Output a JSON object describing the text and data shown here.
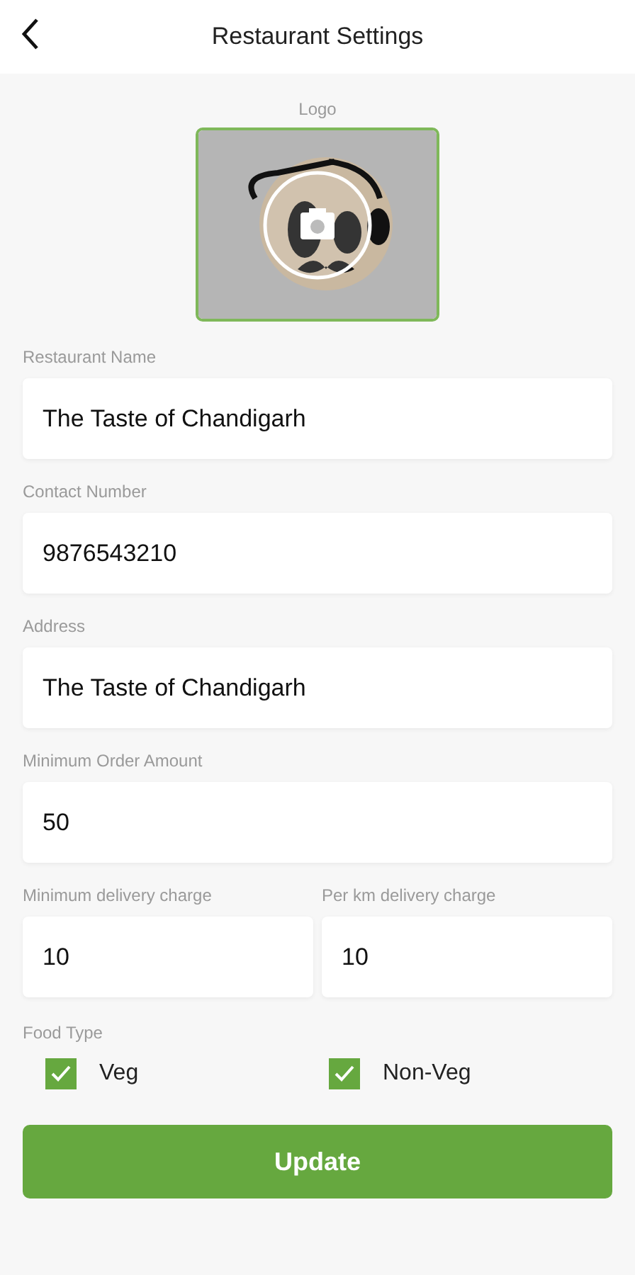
{
  "header": {
    "title": "Restaurant Settings"
  },
  "logo": {
    "label": "Logo",
    "kind": "picture"
  },
  "fields": [
    {
      "kind": "single",
      "items": [
        {
          "label": "Restaurant Name",
          "value": "The Taste of Chandigarh"
        }
      ]
    },
    {
      "kind": "single",
      "items": [
        {
          "label": "Contact Number",
          "value": "9876543210"
        }
      ]
    },
    {
      "kind": "single",
      "items": [
        {
          "label": "Address",
          "value": "The Taste of Chandigarh"
        }
      ]
    },
    {
      "kind": "single",
      "items": [
        {
          "label": "Minimum Order Amount",
          "value": "50"
        }
      ]
    },
    {
      "kind": "pair",
      "items": [
        {
          "label": "Minimum delivery charge",
          "value": "10"
        },
        {
          "label": "Per km delivery charge",
          "value": "10"
        }
      ]
    }
  ],
  "food_type": {
    "label": "Food Type",
    "options": [
      {
        "label": "Veg",
        "checked": true
      },
      {
        "label": "Non-Veg",
        "checked": true
      }
    ]
  },
  "button": "Update"
}
